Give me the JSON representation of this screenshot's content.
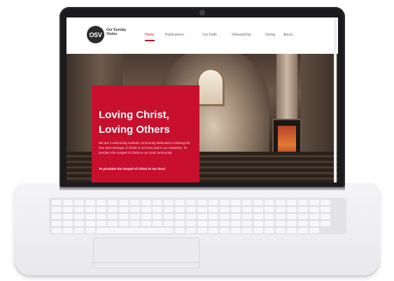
{
  "site": {
    "logo_initials": "OSV",
    "logo_name": "Our Sunday Visitor"
  },
  "nav": [
    {
      "label": "Home",
      "active": true,
      "has_menu": false
    },
    {
      "label": "Publications",
      "active": false,
      "has_menu": true
    },
    {
      "label": "Our Faith",
      "active": false,
      "has_menu": true
    },
    {
      "label": "Stewardship",
      "active": false,
      "has_menu": true
    },
    {
      "label": "Giving",
      "active": false,
      "has_menu": false
    },
    {
      "label": "About",
      "active": false,
      "has_menu": true
    }
  ],
  "hero": {
    "title_line1": "Loving Christ,",
    "title_line2": "Loving Others",
    "body": "We are a welcoming Catholic community dedicated to sharing the love and message of Christ in our lives and in our ministries. To proclaim the Gospel of Christ to our local community.",
    "tagline": "To proclaim the Gospel of Christ to our local",
    "card_color": "#c8102e"
  },
  "colors": {
    "accent": "#c8102e",
    "laptop_body": "#e9e9ed",
    "bezel": "#1b1b1d"
  }
}
